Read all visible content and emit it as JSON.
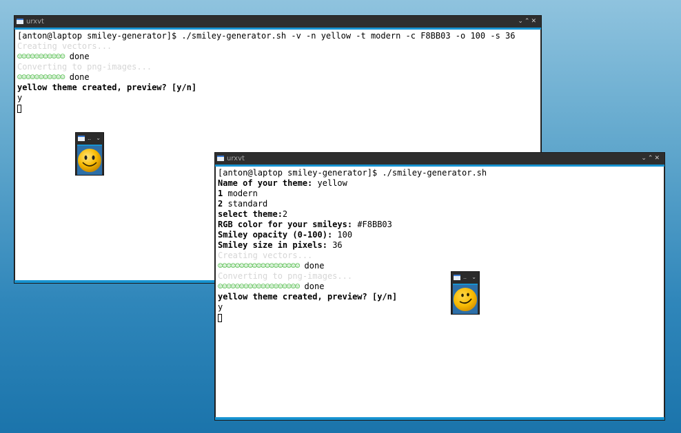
{
  "window1": {
    "title": "urxvt",
    "controls": "⌄⌃✕",
    "lines": [
      "[anton@laptop smiley-generator]$ ./smiley-generator.sh -v -n yellow -t modern -c F8BB03 -o 100 -s 36",
      "Creating vectors...",
      "☺☺☺☺☺☺☺☺☺☺☺",
      "done",
      "Converting to png-images...",
      "☺☺☺☺☺☺☺☺☺☺☺",
      "done",
      "yellow theme created, preview? [y/n]",
      "y"
    ]
  },
  "window2": {
    "title": "urxvt",
    "controls": "⌄⌃✕",
    "prompt": "[anton@laptop smiley-generator]$ ./smiley-generator.sh",
    "theme_label": "Name of your theme:",
    "theme_value": "yellow",
    "opt1_num": "1",
    "opt1_label": "modern",
    "opt2_num": "2",
    "opt2_label": "standard",
    "select_label": "select theme:",
    "select_value": "2",
    "rgb_label": "RGB color for your smileys:",
    "rgb_value": "#F8BB03",
    "opacity_label": "Smiley opacity (0-100):",
    "opacity_value": "100",
    "size_label": "Smiley size in pixels:",
    "size_value": "36",
    "creating": "Creating vectors...",
    "progress1": "☺☺☺☺☺☺☺☺☺☺☺☺☺☺☺☺☺☺☺",
    "done1": "done",
    "converting": "Converting to png-images...",
    "progress2": "☺☺☺☺☺☺☺☺☺☺☺☺☺☺☺☺☺☺☺",
    "done2": "done",
    "created": "yellow theme created, preview? [y/n]",
    "answer": "y"
  },
  "preview1": {
    "dots": "..",
    "chevron": "⌄"
  },
  "preview2": {
    "dots": "..",
    "chevron": "⌄"
  },
  "colors": {
    "accent": "#1793d1",
    "smiley": "#F8BB03",
    "progress": "#41b63a"
  }
}
